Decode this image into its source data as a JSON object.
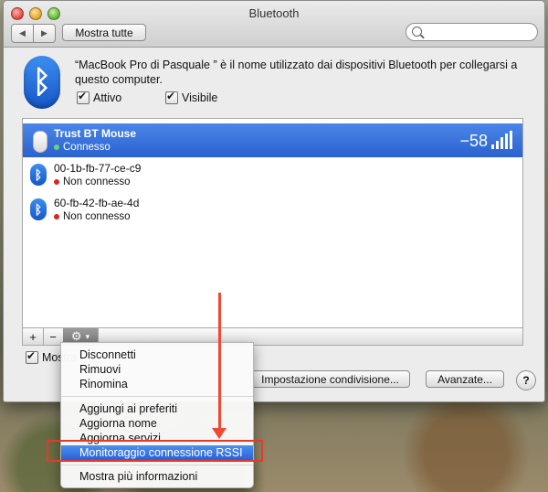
{
  "window": {
    "title": "Bluetooth",
    "show_all_label": "Mostra tutte",
    "search_placeholder": ""
  },
  "info": {
    "description": "“MacBook Pro di Pasquale ” è il nome utilizzato dai dispositivi Bluetooth per collegarsi a questo computer.",
    "active_label": "Attivo",
    "visible_label": "Visibile"
  },
  "devices": [
    {
      "name": "Trust BT Mouse",
      "status": "Connesso",
      "rssi": "−58",
      "icon": "mouse-icon"
    },
    {
      "name": "00-1b-fb-77-ce-c9",
      "status": "Non connesso",
      "icon": "bluetooth-icon"
    },
    {
      "name": "60-fb-42-fb-ae-4d",
      "status": "Non connesso",
      "icon": "bluetooth-icon"
    }
  ],
  "toolbar": {
    "add": "+",
    "remove": "−",
    "gear": "⚙",
    "arrow": "▾"
  },
  "bottom": {
    "show_label": "Mostra",
    "share_setup_label": "Impostazione condivisione...",
    "advanced_label": "Avanzate...",
    "help": "?"
  },
  "menu": {
    "items": [
      "Disconnetti",
      "Rimuovi",
      "Rinomina",
      "Aggiungi ai preferiti",
      "Aggiorna nome",
      "Aggiorna servizi",
      "Monitoraggio connessione RSSI",
      "Mostra più informazioni"
    ]
  },
  "colors": {
    "selection": "#2a62cf",
    "annotation": "#e43a2c"
  }
}
